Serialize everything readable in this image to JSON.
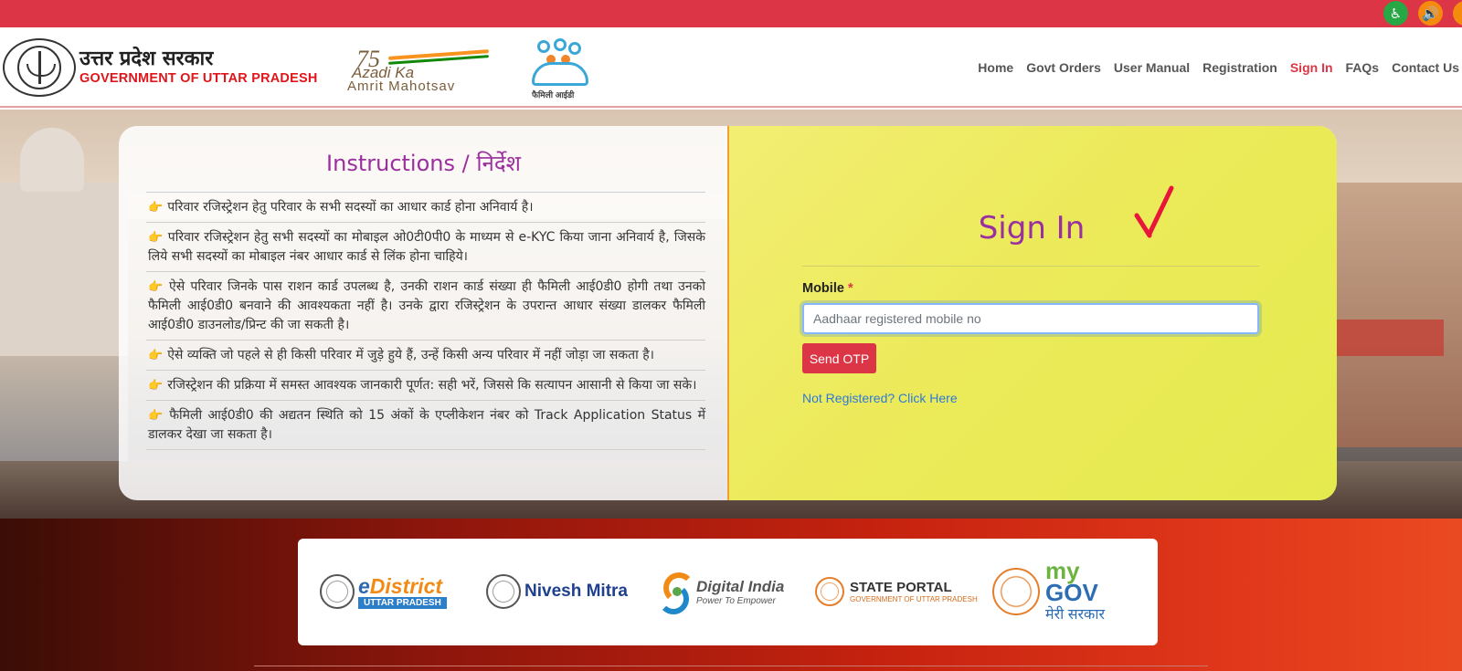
{
  "accessibility": {
    "icons": [
      "wheelchair-icon",
      "speaker-icon",
      "extra-icon"
    ]
  },
  "header": {
    "gov_hindi": "उत्तर प्रदेश सरकार",
    "gov_english": "GOVERNMENT OF UTTAR PRADESH",
    "azadi": {
      "number": "75",
      "line1": "Azadi Ka",
      "line2": "Amrit Mahotsav"
    },
    "family_logo_caption": "फैमिली आईडी"
  },
  "nav": {
    "items": [
      {
        "label": "Home",
        "active": false
      },
      {
        "label": "Govt Orders",
        "active": false
      },
      {
        "label": "User Manual",
        "active": false
      },
      {
        "label": "Registration",
        "active": false
      },
      {
        "label": "Sign In",
        "active": true
      },
      {
        "label": "FAQs",
        "active": false
      },
      {
        "label": "Contact Us",
        "active": false
      }
    ]
  },
  "instructions": {
    "title": "Instructions / निर्देश",
    "items": [
      "परिवार रजिस्ट्रेशन हेतु परिवार के सभी सदस्यों का आधार कार्ड होना अनिवार्य है।",
      "परिवार रजिस्ट्रेशन हेतु सभी सदस्यों का मोबाइल ओ0टी0पी0 के माध्यम से e-KYC किया जाना अनिवार्य है, जिसके लिये सभी सदस्यों का मोबाइल नंबर आधार कार्ड से लिंक होना चाहिये।",
      "ऐसे परिवार जिनके पास राशन कार्ड उपलब्ध है, उनकी राशन कार्ड संख्या ही फैमिली आई0डी0 होगी तथा उनको फैमिली आई0डी0 बनवाने की आवश्यकता नहीं है। उनके द्वारा रजिस्ट्रेशन के उपरान्त आधार संख्या डालकर फैमिली आई0डी0 डाउनलोड/प्रिन्ट की जा सकती है।",
      "ऐसे व्यक्ति जो पहले से ही किसी परिवार में जुड़े हुये हैं, उन्हें किसी अन्य परिवार में नहीं जोड़ा जा सकता है।",
      "रजिस्ट्रेशन की प्रक्रिया में समस्त आवश्यक जानकारी पूर्णत: सही भरें, जिससे कि सत्यापन आसानी से किया जा सके।",
      "फैमिली आई0डी0 की अद्यतन स्थिति को 15 अंकों के एप्लीकेशन नंबर को Track Application Status में डालकर देखा जा सकता है।"
    ]
  },
  "signin": {
    "title": "Sign In",
    "mobile_label": "Mobile",
    "required_mark": "*",
    "mobile_value": "",
    "mobile_placeholder": "Aadhaar registered mobile no",
    "send_otp_label": "Send OTP",
    "register_link": "Not Registered? Click Here"
  },
  "footer": {
    "logos": [
      {
        "name": "eDistrict",
        "sub": "UTTAR PRADESH"
      },
      {
        "name": "Nivesh Mitra"
      },
      {
        "name": "Digital India",
        "sub": "Power To Empower"
      },
      {
        "name": "STATE PORTAL",
        "sub": "GOVERNMENT OF UTTAR PRADESH"
      },
      {
        "name_my": "my",
        "name_gov": "GOV",
        "sub": "मेरी सरकार"
      }
    ]
  },
  "colors": {
    "primary_red": "#dc3545",
    "title_purple": "#9a2fa0",
    "signin_yellow": "#ecea5a",
    "link_blue": "#2d7ad6"
  }
}
